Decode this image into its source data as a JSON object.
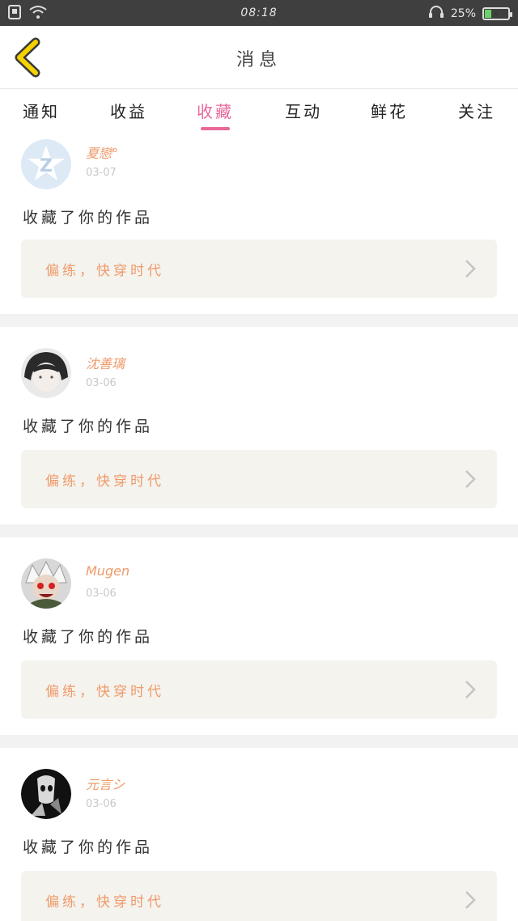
{
  "status_bar": {
    "time": "08:18",
    "battery": "25%",
    "battery_level": 0.25,
    "icons": [
      "notification-icon",
      "wifi-icon",
      "headset-icon",
      "battery-icon"
    ]
  },
  "header": {
    "title": "消息",
    "back_icon": "chevron-left-icon",
    "accent_color": "#f5d200"
  },
  "tabs": [
    {
      "label": "通知",
      "active": false
    },
    {
      "label": "收益",
      "active": false
    },
    {
      "label": "收藏",
      "active": true
    },
    {
      "label": "互动",
      "active": false
    },
    {
      "label": "鲜花",
      "active": false
    },
    {
      "label": "关注",
      "active": false
    }
  ],
  "colors": {
    "active_tab": "#e8689a",
    "name": "#ef9a6a",
    "work": "#ef9a6a",
    "work_bg": "#f4f3ee"
  },
  "feed": [
    {
      "username": "夏戀°",
      "date": "03-07",
      "action": "收藏了你的作品",
      "work_title": "偏练，快穿时代"
    },
    {
      "username": "沈善璃",
      "date": "03-06",
      "action": "收藏了你的作品",
      "work_title": "偏练，快穿时代"
    },
    {
      "username": "Mugen",
      "date": "03-06",
      "action": "收藏了你的作品",
      "work_title": "偏练，快穿时代"
    },
    {
      "username": "元言シ",
      "date": "03-06",
      "action": "收藏了你的作品",
      "work_title": "偏练，快穿时代"
    }
  ]
}
